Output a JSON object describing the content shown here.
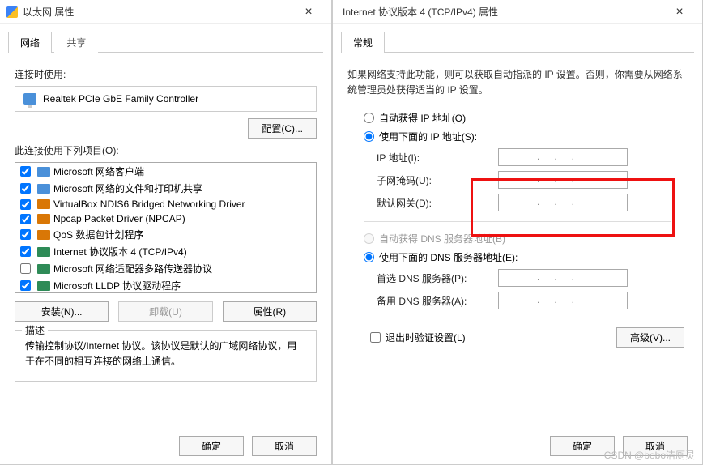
{
  "win1": {
    "title": "以太网 属性",
    "tabs": [
      "网络",
      "共享"
    ],
    "connect_label": "连接时使用:",
    "adapter": "Realtek PCIe GbE Family Controller",
    "configure": "配置(C)...",
    "uses_label": "此连接使用下列项目(O):",
    "items": [
      {
        "label": "Microsoft 网络客户端",
        "checked": true,
        "icon": "b"
      },
      {
        "label": "Microsoft 网络的文件和打印机共享",
        "checked": true,
        "icon": "b"
      },
      {
        "label": "VirtualBox NDIS6 Bridged Networking Driver",
        "checked": true,
        "icon": "o"
      },
      {
        "label": "Npcap Packet Driver (NPCAP)",
        "checked": true,
        "icon": "o"
      },
      {
        "label": "QoS 数据包计划程序",
        "checked": true,
        "icon": "o"
      },
      {
        "label": "Internet 协议版本 4 (TCP/IPv4)",
        "checked": true,
        "icon": "g"
      },
      {
        "label": "Microsoft 网络适配器多路传送器协议",
        "checked": false,
        "icon": "g"
      },
      {
        "label": "Microsoft LLDP 协议驱动程序",
        "checked": true,
        "icon": "g"
      }
    ],
    "install": "安装(N)...",
    "uninstall": "卸载(U)",
    "properties": "属性(R)",
    "desc_title": "描述",
    "desc": "传输控制协议/Internet 协议。该协议是默认的广域网络协议，用于在不同的相互连接的网络上通信。",
    "ok": "确定",
    "cancel": "取消"
  },
  "win2": {
    "title": "Internet 协议版本 4 (TCP/IPv4) 属性",
    "tab": "常规",
    "intro": "如果网络支持此功能，则可以获取自动指派的 IP 设置。否则，你需要从网络系统管理员处获得适当的 IP 设置。",
    "auto_ip": "自动获得 IP 地址(O)",
    "manual_ip": "使用下面的 IP 地址(S):",
    "ip_label": "IP 地址(I):",
    "mask_label": "子网掩码(U):",
    "gw_label": "默认网关(D):",
    "auto_dns": "自动获得 DNS 服务器地址(B)",
    "manual_dns": "使用下面的 DNS 服务器地址(E):",
    "dns1_label": "首选 DNS 服务器(P):",
    "dns2_label": "备用 DNS 服务器(A):",
    "validate": "退出时验证设置(L)",
    "advanced": "高级(V)...",
    "ok": "确定",
    "cancel": "取消",
    "ip_placeholder": ".   .   ."
  },
  "watermark": "CSDN @bobo洁厕灵"
}
